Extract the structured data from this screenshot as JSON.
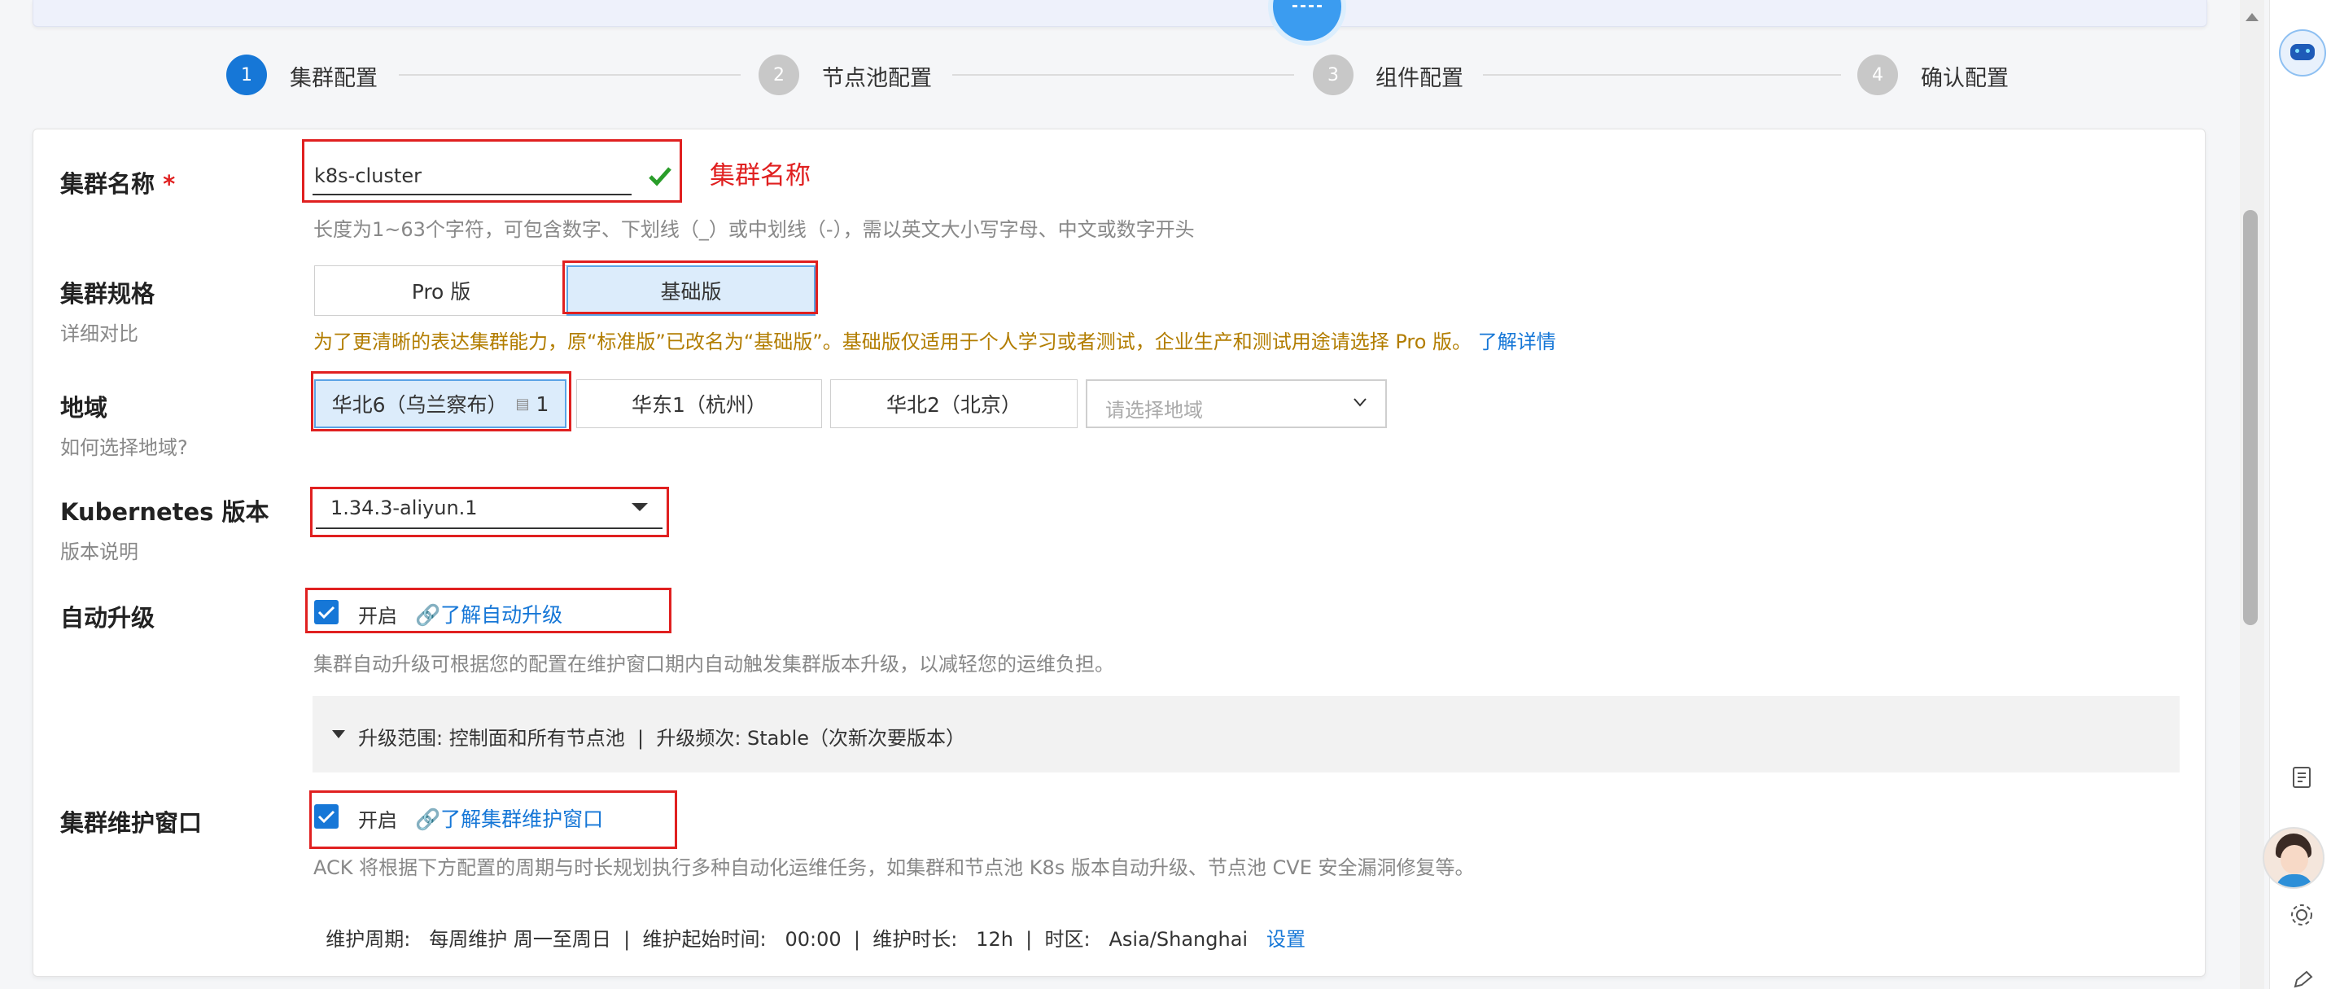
{
  "steps": [
    {
      "num": "1",
      "label": "集群配置"
    },
    {
      "num": "2",
      "label": "节点池配置"
    },
    {
      "num": "3",
      "label": "组件配置"
    },
    {
      "num": "4",
      "label": "确认配置"
    }
  ],
  "cluster_name": {
    "label": "集群名称",
    "required": "*",
    "value": "k8s-cluster",
    "annotation": "集群名称",
    "help": "长度为1~63个字符，可包含数字、下划线（_）或中划线（-），需以英文大小写字母、中文或数字开头"
  },
  "cluster_spec": {
    "label": "集群规格",
    "sublabel": "详细对比",
    "options": [
      "Pro 版",
      "基础版"
    ],
    "selected": "基础版",
    "notice": "为了更清晰的表达集群能力，原“标准版”已改名为“基础版”。基础版仅适用于个人学习或者测试，企业生产和测试用途请选择 Pro 版。",
    "notice_link": "了解详情"
  },
  "region": {
    "label": "地域",
    "sublabel": "如何选择地域?",
    "options": [
      {
        "label": "华北6（乌兰察布）",
        "badge": "1"
      },
      {
        "label": "华东1（杭州）"
      },
      {
        "label": "华北2（北京）"
      }
    ],
    "select_placeholder": "请选择地域"
  },
  "k8s_version": {
    "label": "Kubernetes 版本",
    "sublabel": "版本说明",
    "value": "1.34.3-aliyun.1"
  },
  "auto_upgrade": {
    "label": "自动升级",
    "checkbox_label": "开启",
    "link": "了解自动升级",
    "help": "集群自动升级可根据您的配置在维护窗口期内自动触发集群版本升级，以减轻您的运维负担。",
    "panel_text": "升级范围: 控制面和所有节点池  |  升级频次: Stable（次新次要版本）"
  },
  "maintenance": {
    "label": "集群维护窗口",
    "checkbox_label": "开启",
    "link": "了解集群维护窗口",
    "help": "ACK 将根据下方配置的周期与时长规划执行多种自动化运维任务，如集群和节点池 K8s 版本自动升级、节点池 CVE 安全漏洞修复等。",
    "summary": "维护周期:   每周维护 周一至周日  |  维护起始时间:   00:00  |  维护时长:   12h  |  时区:   Asia/Shanghai",
    "settings_link": "设置"
  },
  "colors": {
    "primary": "#1677d7",
    "warning": "#b27d00",
    "annotation": "#e02020"
  }
}
